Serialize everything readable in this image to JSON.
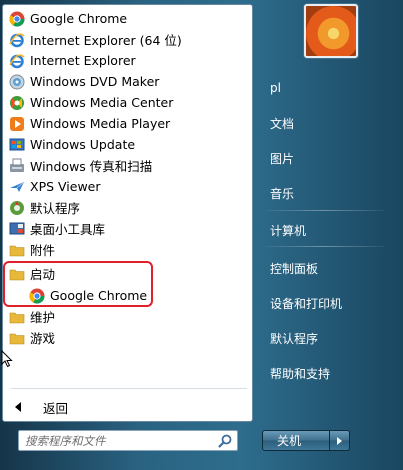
{
  "programs": [
    {
      "label": "Google Chrome",
      "icon": "chrome-icon"
    },
    {
      "label": "Internet Explorer (64 位)",
      "icon": "ie-icon"
    },
    {
      "label": "Internet Explorer",
      "icon": "ie-icon"
    },
    {
      "label": "Windows DVD Maker",
      "icon": "dvd-maker-icon"
    },
    {
      "label": "Windows Media Center",
      "icon": "media-center-icon"
    },
    {
      "label": "Windows Media Player",
      "icon": "media-player-icon"
    },
    {
      "label": "Windows Update",
      "icon": "windows-update-icon"
    },
    {
      "label": "Windows 传真和扫描",
      "icon": "fax-scan-icon"
    },
    {
      "label": "XPS Viewer",
      "icon": "xps-viewer-icon"
    },
    {
      "label": "默认程序",
      "icon": "default-programs-icon"
    },
    {
      "label": "桌面小工具库",
      "icon": "gadgets-icon"
    },
    {
      "label": "附件",
      "icon": "folder-icon"
    },
    {
      "label": "启动",
      "icon": "folder-icon"
    },
    {
      "label": "Google Chrome",
      "icon": "chrome-icon"
    },
    {
      "label": "维护",
      "icon": "folder-icon"
    },
    {
      "label": "游戏",
      "icon": "folder-icon"
    }
  ],
  "back_label": "返回",
  "search": {
    "placeholder": "搜索程序和文件"
  },
  "right_items": [
    "pl",
    "文档",
    "图片",
    "音乐",
    "计算机",
    "控制面板",
    "设备和打印机",
    "默认程序",
    "帮助和支持"
  ],
  "shutdown_label": "关机",
  "colors": {
    "highlight": "#e0202a",
    "folder": "#e8b83a"
  }
}
